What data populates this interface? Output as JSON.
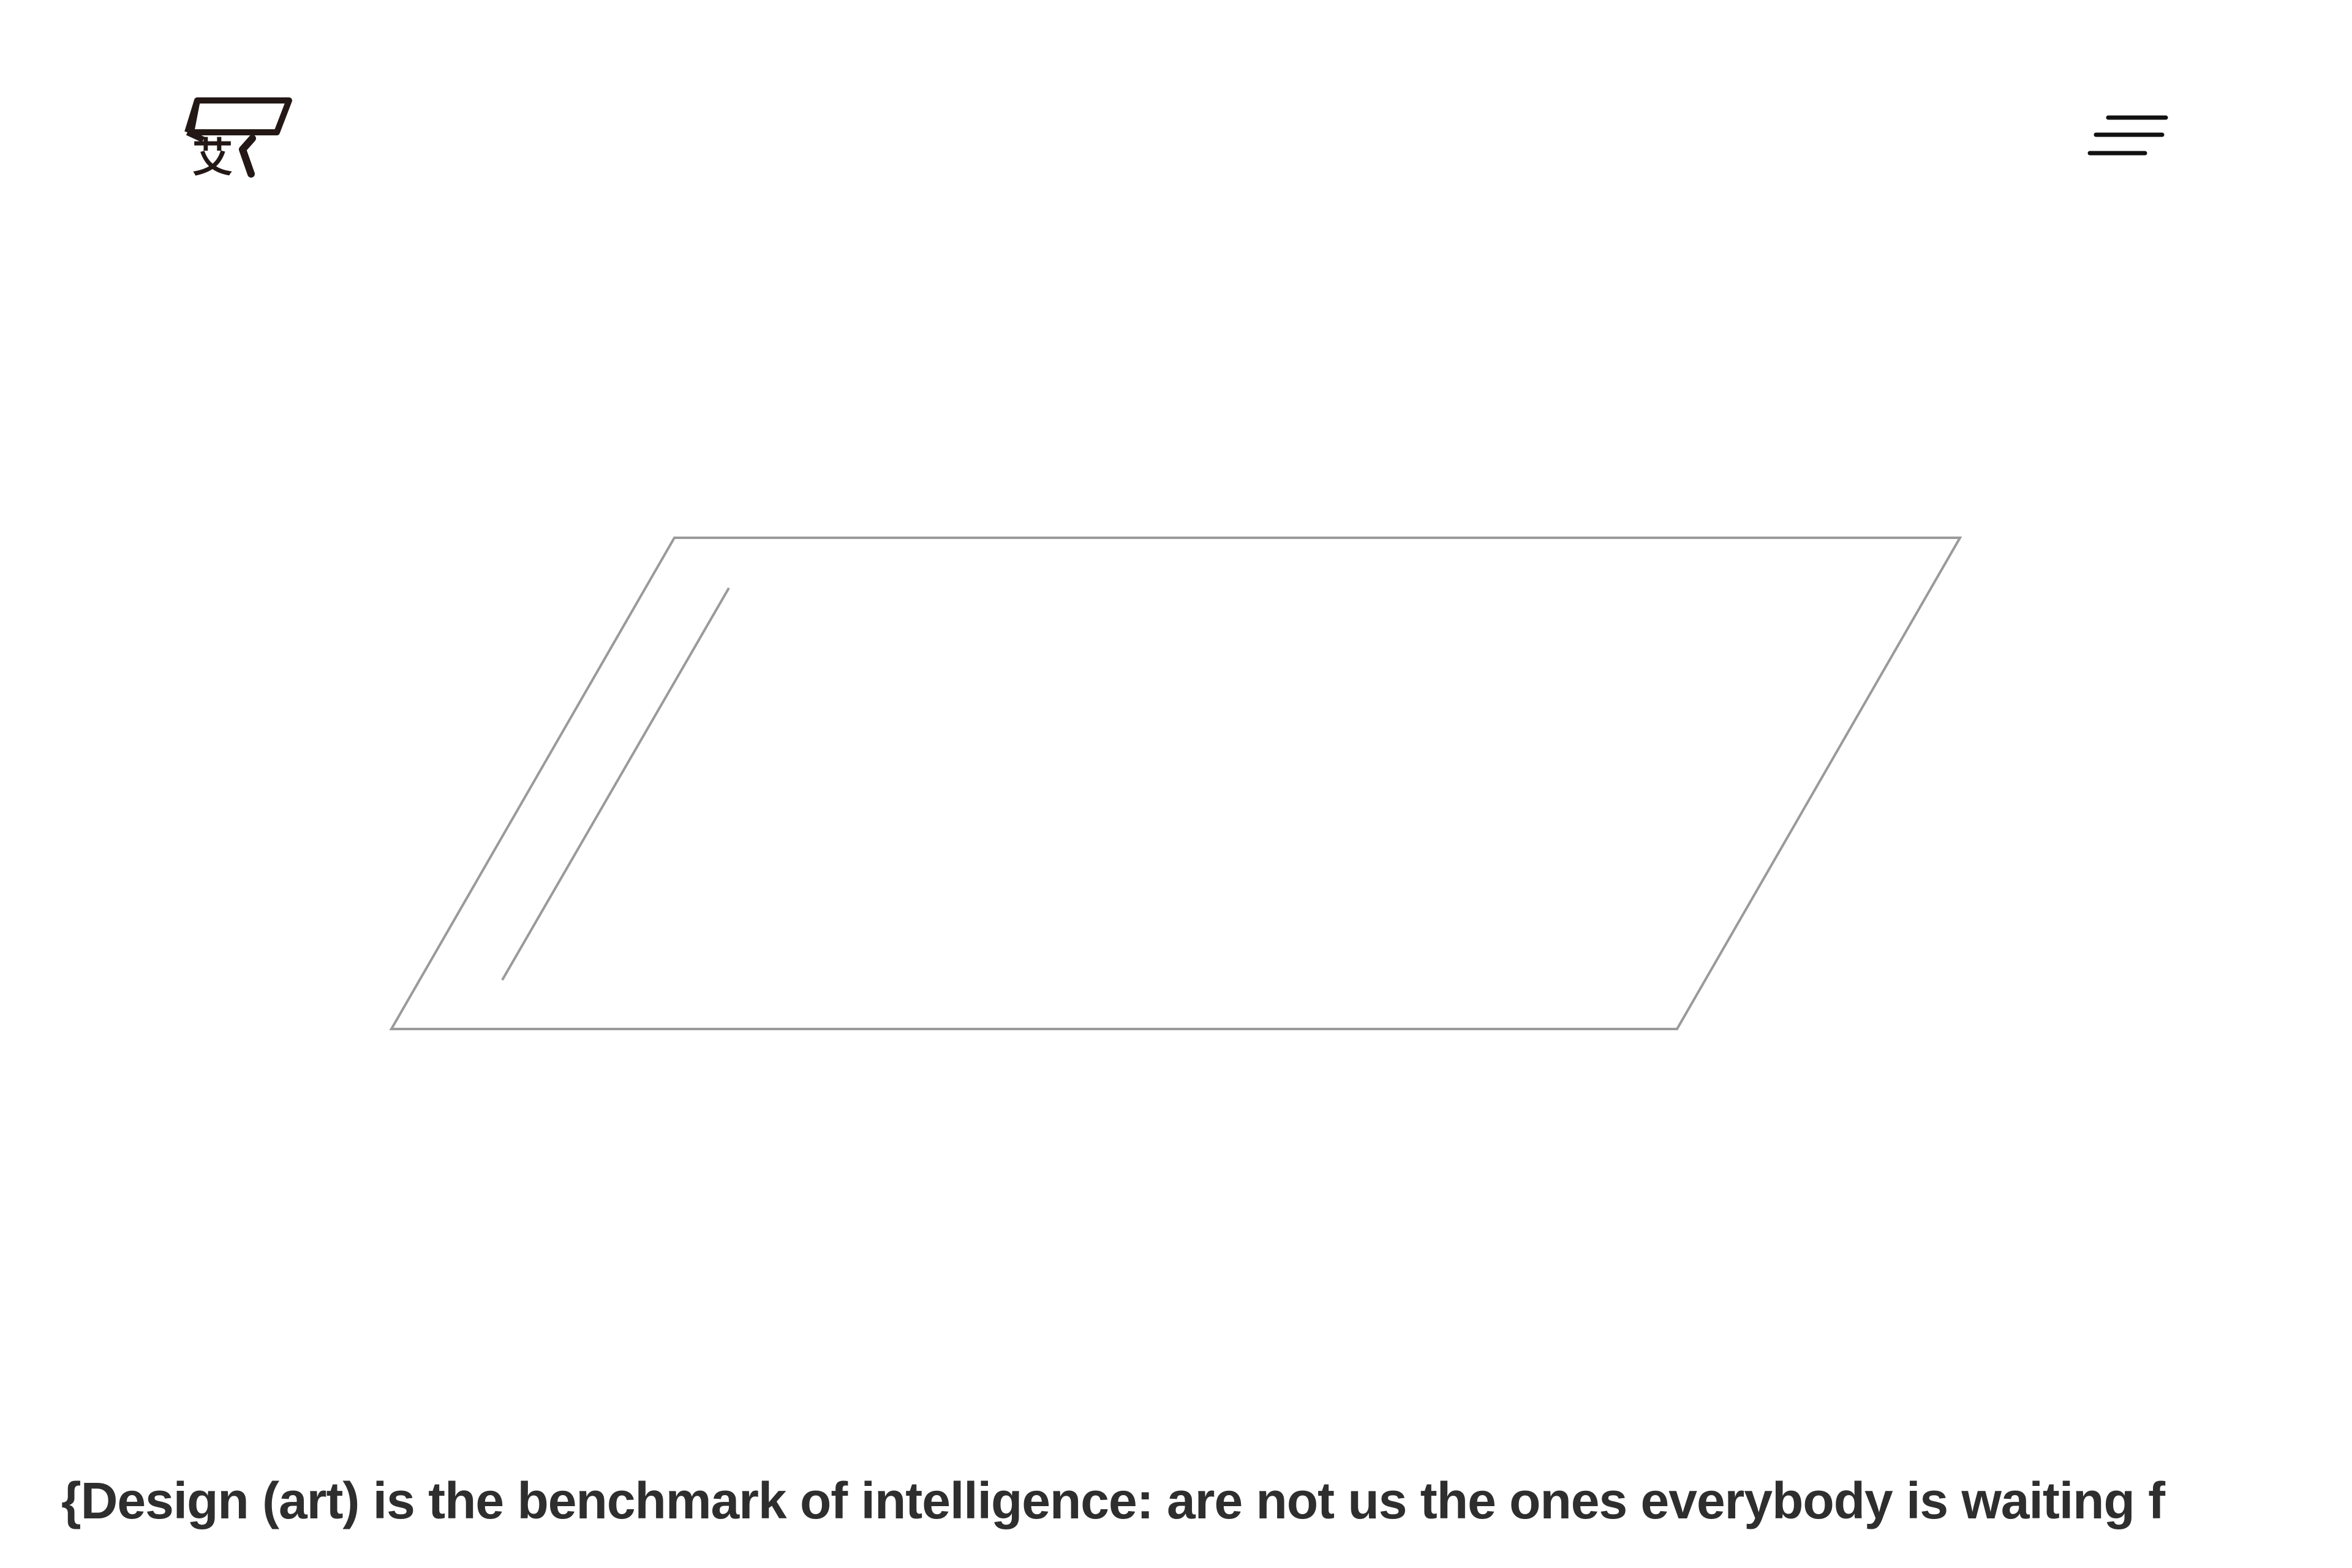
{
  "header": {
    "logo": {
      "icon": "logo-mark",
      "glyph": "艾"
    },
    "menu": {
      "icon": "hamburger-menu-icon"
    }
  },
  "hero": {
    "shape": "parallelogram-outline",
    "stroke_color": "#9a9a9a"
  },
  "footer": {
    "tagline": "{Design (art) is the benchmark of intelligence: are not us the ones everybody is waiting f"
  },
  "colors": {
    "background": "#ffffff",
    "text": "#2e2e2e",
    "logo": "#231815"
  }
}
